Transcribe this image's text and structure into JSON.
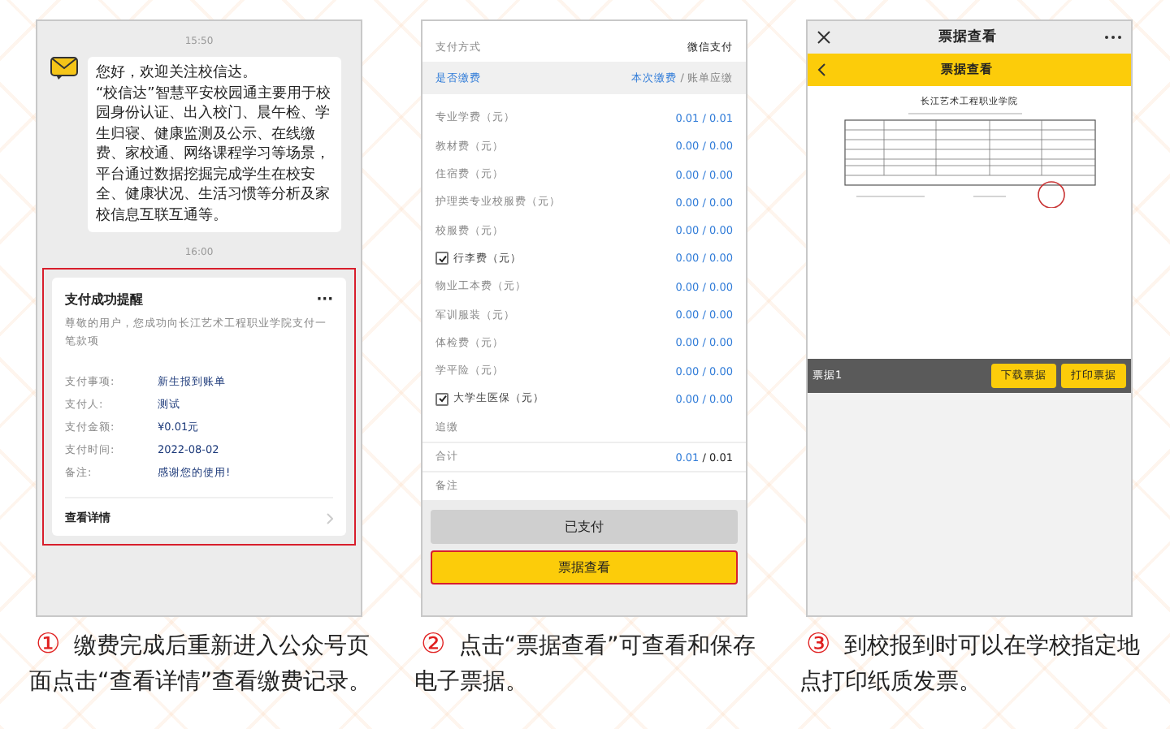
{
  "chat_panel": {
    "times": [
      "15:50",
      "16:00"
    ],
    "message": [
      "您好，欢迎关注校信达。",
      "“校信达”智慧平安校园通主要用于校园身份认证、出入校门、晨午检、学生归寝、健康监测及公示、在线缴费、家校通、网络课程学习等场景，平台通过数据挖掘完成学生在校安全、健康状况、生活习惯等分析及家校信息互联互通等。"
    ],
    "card": {
      "title": "支付成功提醒",
      "more": "···",
      "intro": "尊敬的用户，您成功向长江艺术工程职业学院支付一笔款项",
      "rows": [
        {
          "label": "支付事项:",
          "value": "新生报到账单"
        },
        {
          "label": "支付人:",
          "value": "测试"
        },
        {
          "label": "支付金额:",
          "value": "¥0.01元"
        },
        {
          "label": "支付时间:",
          "value": "2022-08-02"
        },
        {
          "label": "备注:",
          "value": "感谢您的使用!"
        }
      ],
      "link": "查看详情"
    }
  },
  "bill_panel": {
    "method": {
      "label": "支付方式",
      "value": "微信支付"
    },
    "header": {
      "label": "是否缴费",
      "current": "本次缴费",
      "rest": "/ 账单应缴"
    },
    "fees": [
      {
        "kind": "plain",
        "label": "专业学费（元）",
        "amount": "0.01 / 0.01"
      },
      {
        "kind": "plain",
        "label": "教材费（元）",
        "amount": "0.00 / 0.00"
      },
      {
        "kind": "plain",
        "label": "住宿费（元）",
        "amount": "0.00 / 0.00"
      },
      {
        "kind": "plain",
        "label": "护理类专业校服费（元）",
        "amount": "0.00 / 0.00"
      },
      {
        "kind": "plain",
        "label": "校服费（元）",
        "amount": "0.00 / 0.00"
      },
      {
        "kind": "check",
        "checked": true,
        "label": "行李费（元）",
        "amount": "0.00 / 0.00"
      },
      {
        "kind": "plain",
        "label": "物业工本费（元）",
        "amount": "0.00 / 0.00"
      },
      {
        "kind": "plain",
        "label": "军训服装（元）",
        "amount": "0.00 / 0.00"
      },
      {
        "kind": "plain",
        "label": "体检费（元）",
        "amount": "0.00 / 0.00"
      },
      {
        "kind": "plain",
        "label": "学平险（元）",
        "amount": "0.00 / 0.00"
      },
      {
        "kind": "check",
        "checked": true,
        "label": "大学生医保（元）",
        "amount": "0.00 / 0.00"
      }
    ],
    "extra": "追缴",
    "total": {
      "label": "合计",
      "paid": "0.01",
      "rest": "/ 0.01"
    },
    "note": "备注",
    "buttons": [
      {
        "label": "已支付",
        "disabled": true
      },
      {
        "label": "票据查看",
        "disabled": false
      }
    ]
  },
  "receipt_panel": {
    "window_title": "票据查看",
    "nav_title": "票据查看",
    "school": "长江艺术工程职业学院",
    "receipt_name": "票据1",
    "buttons": [
      "下载票据",
      "打印票据"
    ]
  },
  "captions": [
    {
      "number": "①",
      "text": "缴费完成后重新进入公众号页面点击“查看详情”查看缴费记录。"
    },
    {
      "number": "②",
      "text": "点击“票据查看”可查看和保存电子票据。"
    },
    {
      "number": "③",
      "text": "到校报到时可以在学校指定地点打印纸质发票。"
    }
  ]
}
